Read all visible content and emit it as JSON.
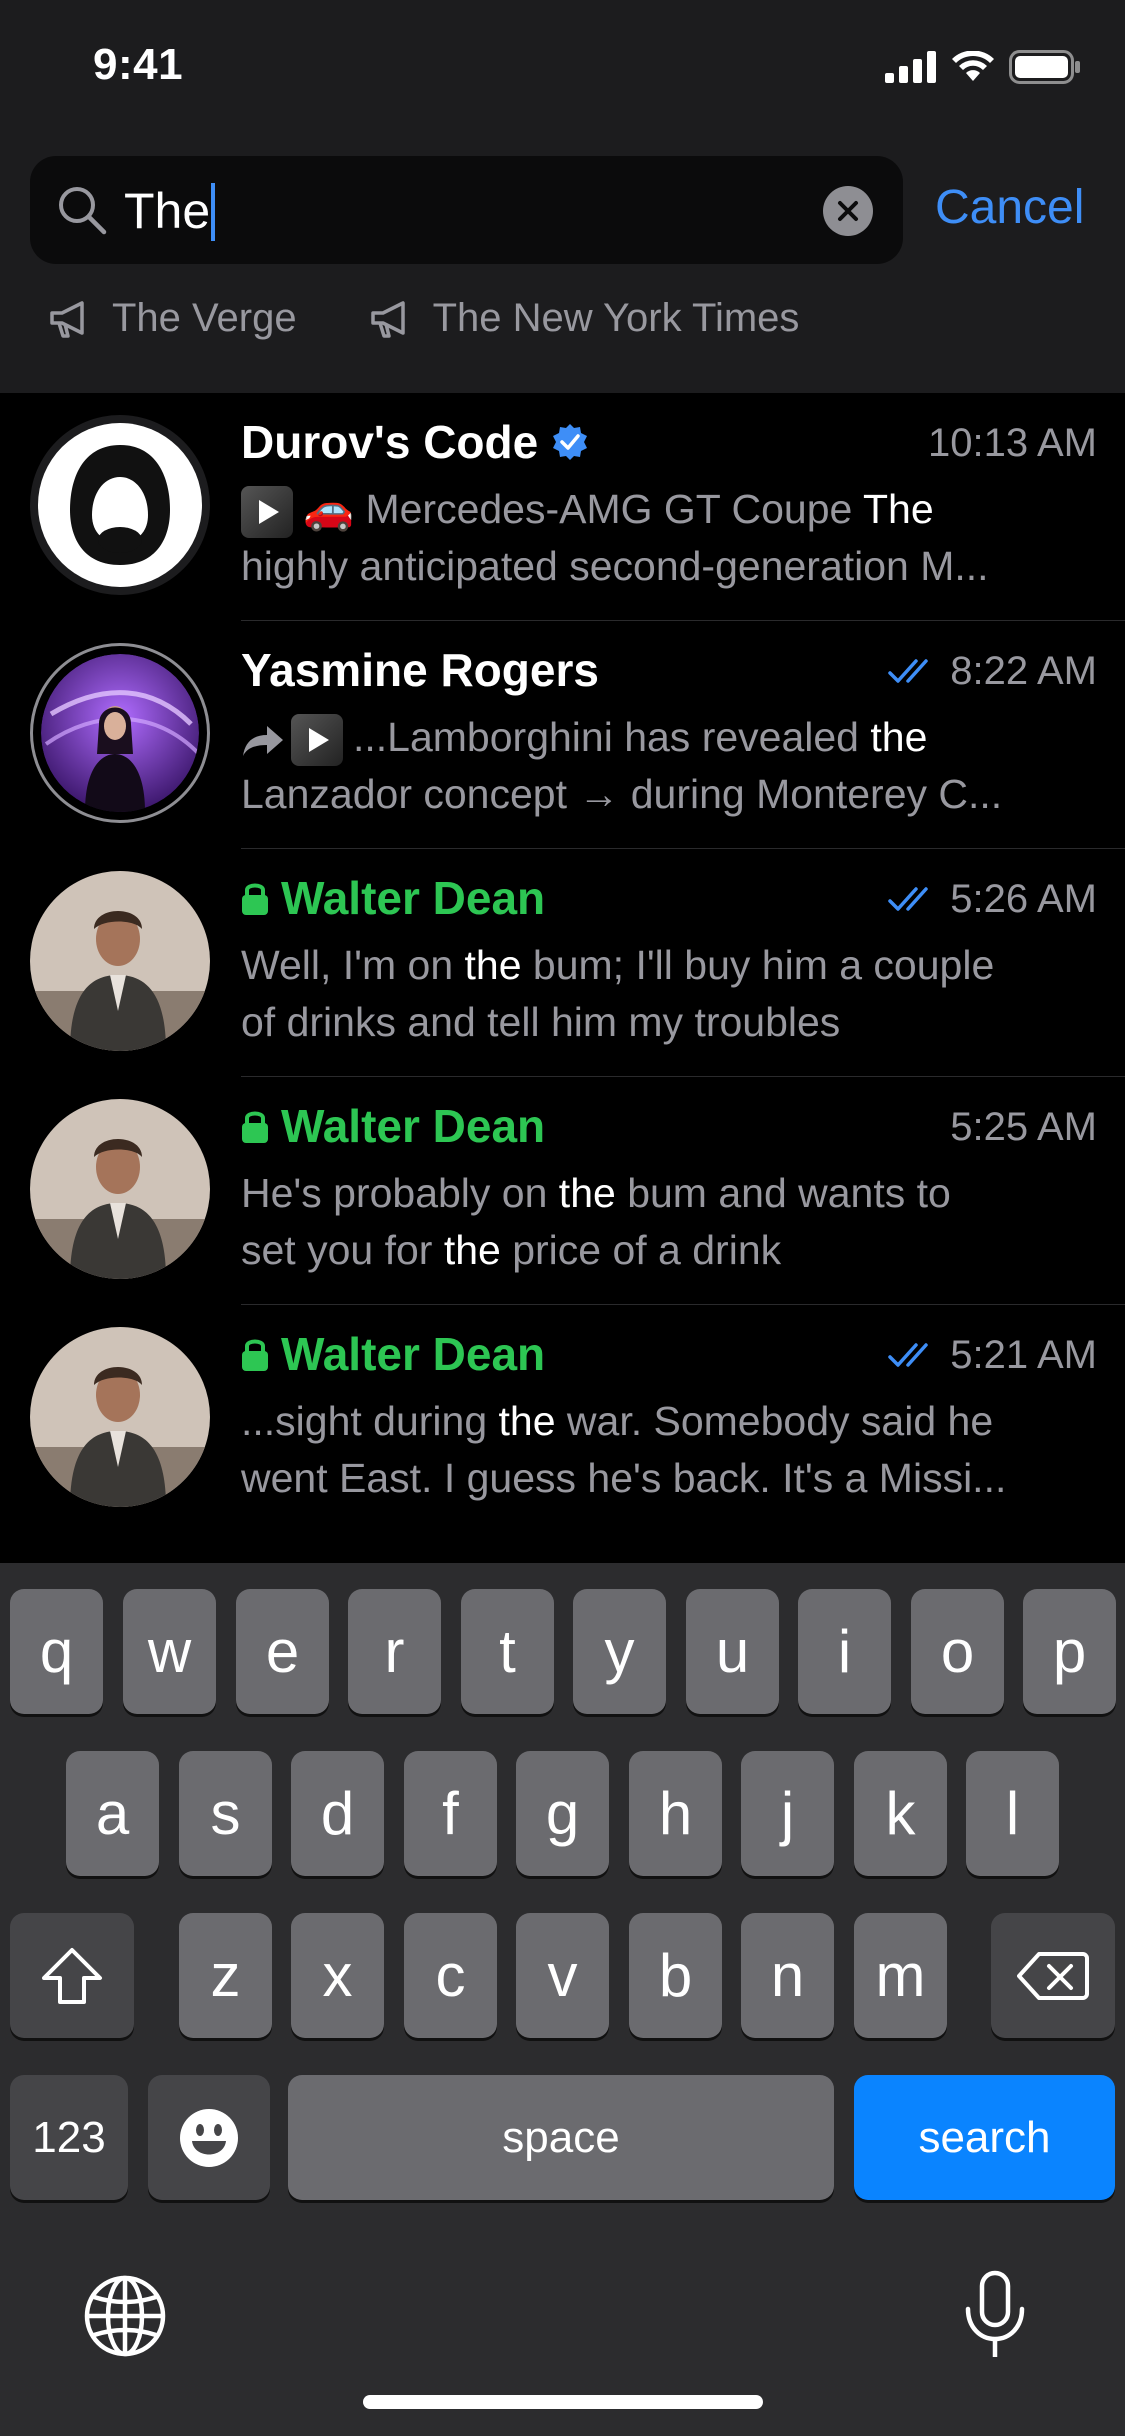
{
  "status": {
    "time": "9:41"
  },
  "search": {
    "query": "The",
    "cancel_label": "Cancel"
  },
  "chips": [
    {
      "label": "The Verge"
    },
    {
      "label": "The New York Times"
    }
  ],
  "chats": [
    {
      "name": "Durov's Code",
      "time": "10:13 AM",
      "verified": true,
      "emoji": "🚗",
      "line1_pre": "Mercedes-AMG GT Coupe ",
      "line1_hl": "The",
      "line2": "highly anticipated second-generation M..."
    },
    {
      "name": "Yasmine Rogers",
      "time": "8:22 AM",
      "line1_pre": "...Lamborghini has revealed ",
      "line1_hl": "the",
      "line2": "Lanzador concept → during Monterey C..."
    },
    {
      "name": "Walter Dean",
      "time": "5:26 AM",
      "line1_pre": "Well, I'm on ",
      "line1_hl": "the",
      "line1_post": " bum; I'll buy him a couple",
      "line2": "of drinks and tell him my troubles"
    },
    {
      "name": "Walter Dean",
      "time": "5:25 AM",
      "line1_pre": "He's probably on ",
      "line1_hl": "the",
      "line1_post": " bum and wants to",
      "line2_pre": "set you for ",
      "line2_hl": "the",
      "line2_post": " price of a drink"
    },
    {
      "name": "Walter Dean",
      "time": "5:21 AM",
      "line1_pre": "...sight during ",
      "line1_hl": "the",
      "line1_post": " war. Somebody said he",
      "line2": "went East. I guess he's back. It's a Missi..."
    }
  ],
  "keyboard": {
    "row1": [
      "q",
      "w",
      "e",
      "r",
      "t",
      "y",
      "u",
      "i",
      "o",
      "p"
    ],
    "row2": [
      "a",
      "s",
      "d",
      "f",
      "g",
      "h",
      "j",
      "k",
      "l"
    ],
    "row3": [
      "z",
      "x",
      "c",
      "v",
      "b",
      "n",
      "m"
    ],
    "numbers_label": "123",
    "space_label": "space",
    "search_label": "search"
  },
  "colors": {
    "accent": "#3e8ef7",
    "secret_chat": "#2dc653",
    "search_key": "#0a84ff"
  }
}
